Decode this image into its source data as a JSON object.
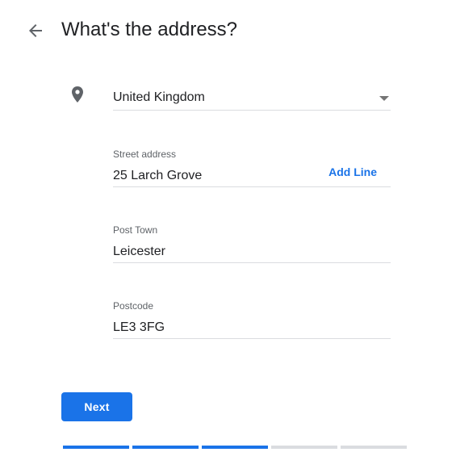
{
  "header": {
    "back_icon": "arrow-back-icon",
    "title": "What's the address?"
  },
  "country": {
    "icon": "location-pin-icon",
    "value": "United Kingdom"
  },
  "street": {
    "label": "Street address",
    "value": "25 Larch Grove",
    "add_line_label": "Add Line"
  },
  "town": {
    "label": "Post Town",
    "value": "Leicester"
  },
  "postcode": {
    "label": "Postcode",
    "value": "LE3 3FG"
  },
  "next_button": {
    "label": "Next"
  },
  "progress": {
    "total_steps": 5,
    "completed_steps": 3,
    "active_color": "#1a73e8",
    "inactive_color": "#dadce0"
  },
  "colors": {
    "accent": "#1a73e8",
    "text": "#202124",
    "label": "#5f6368",
    "divider": "#dadce0"
  }
}
